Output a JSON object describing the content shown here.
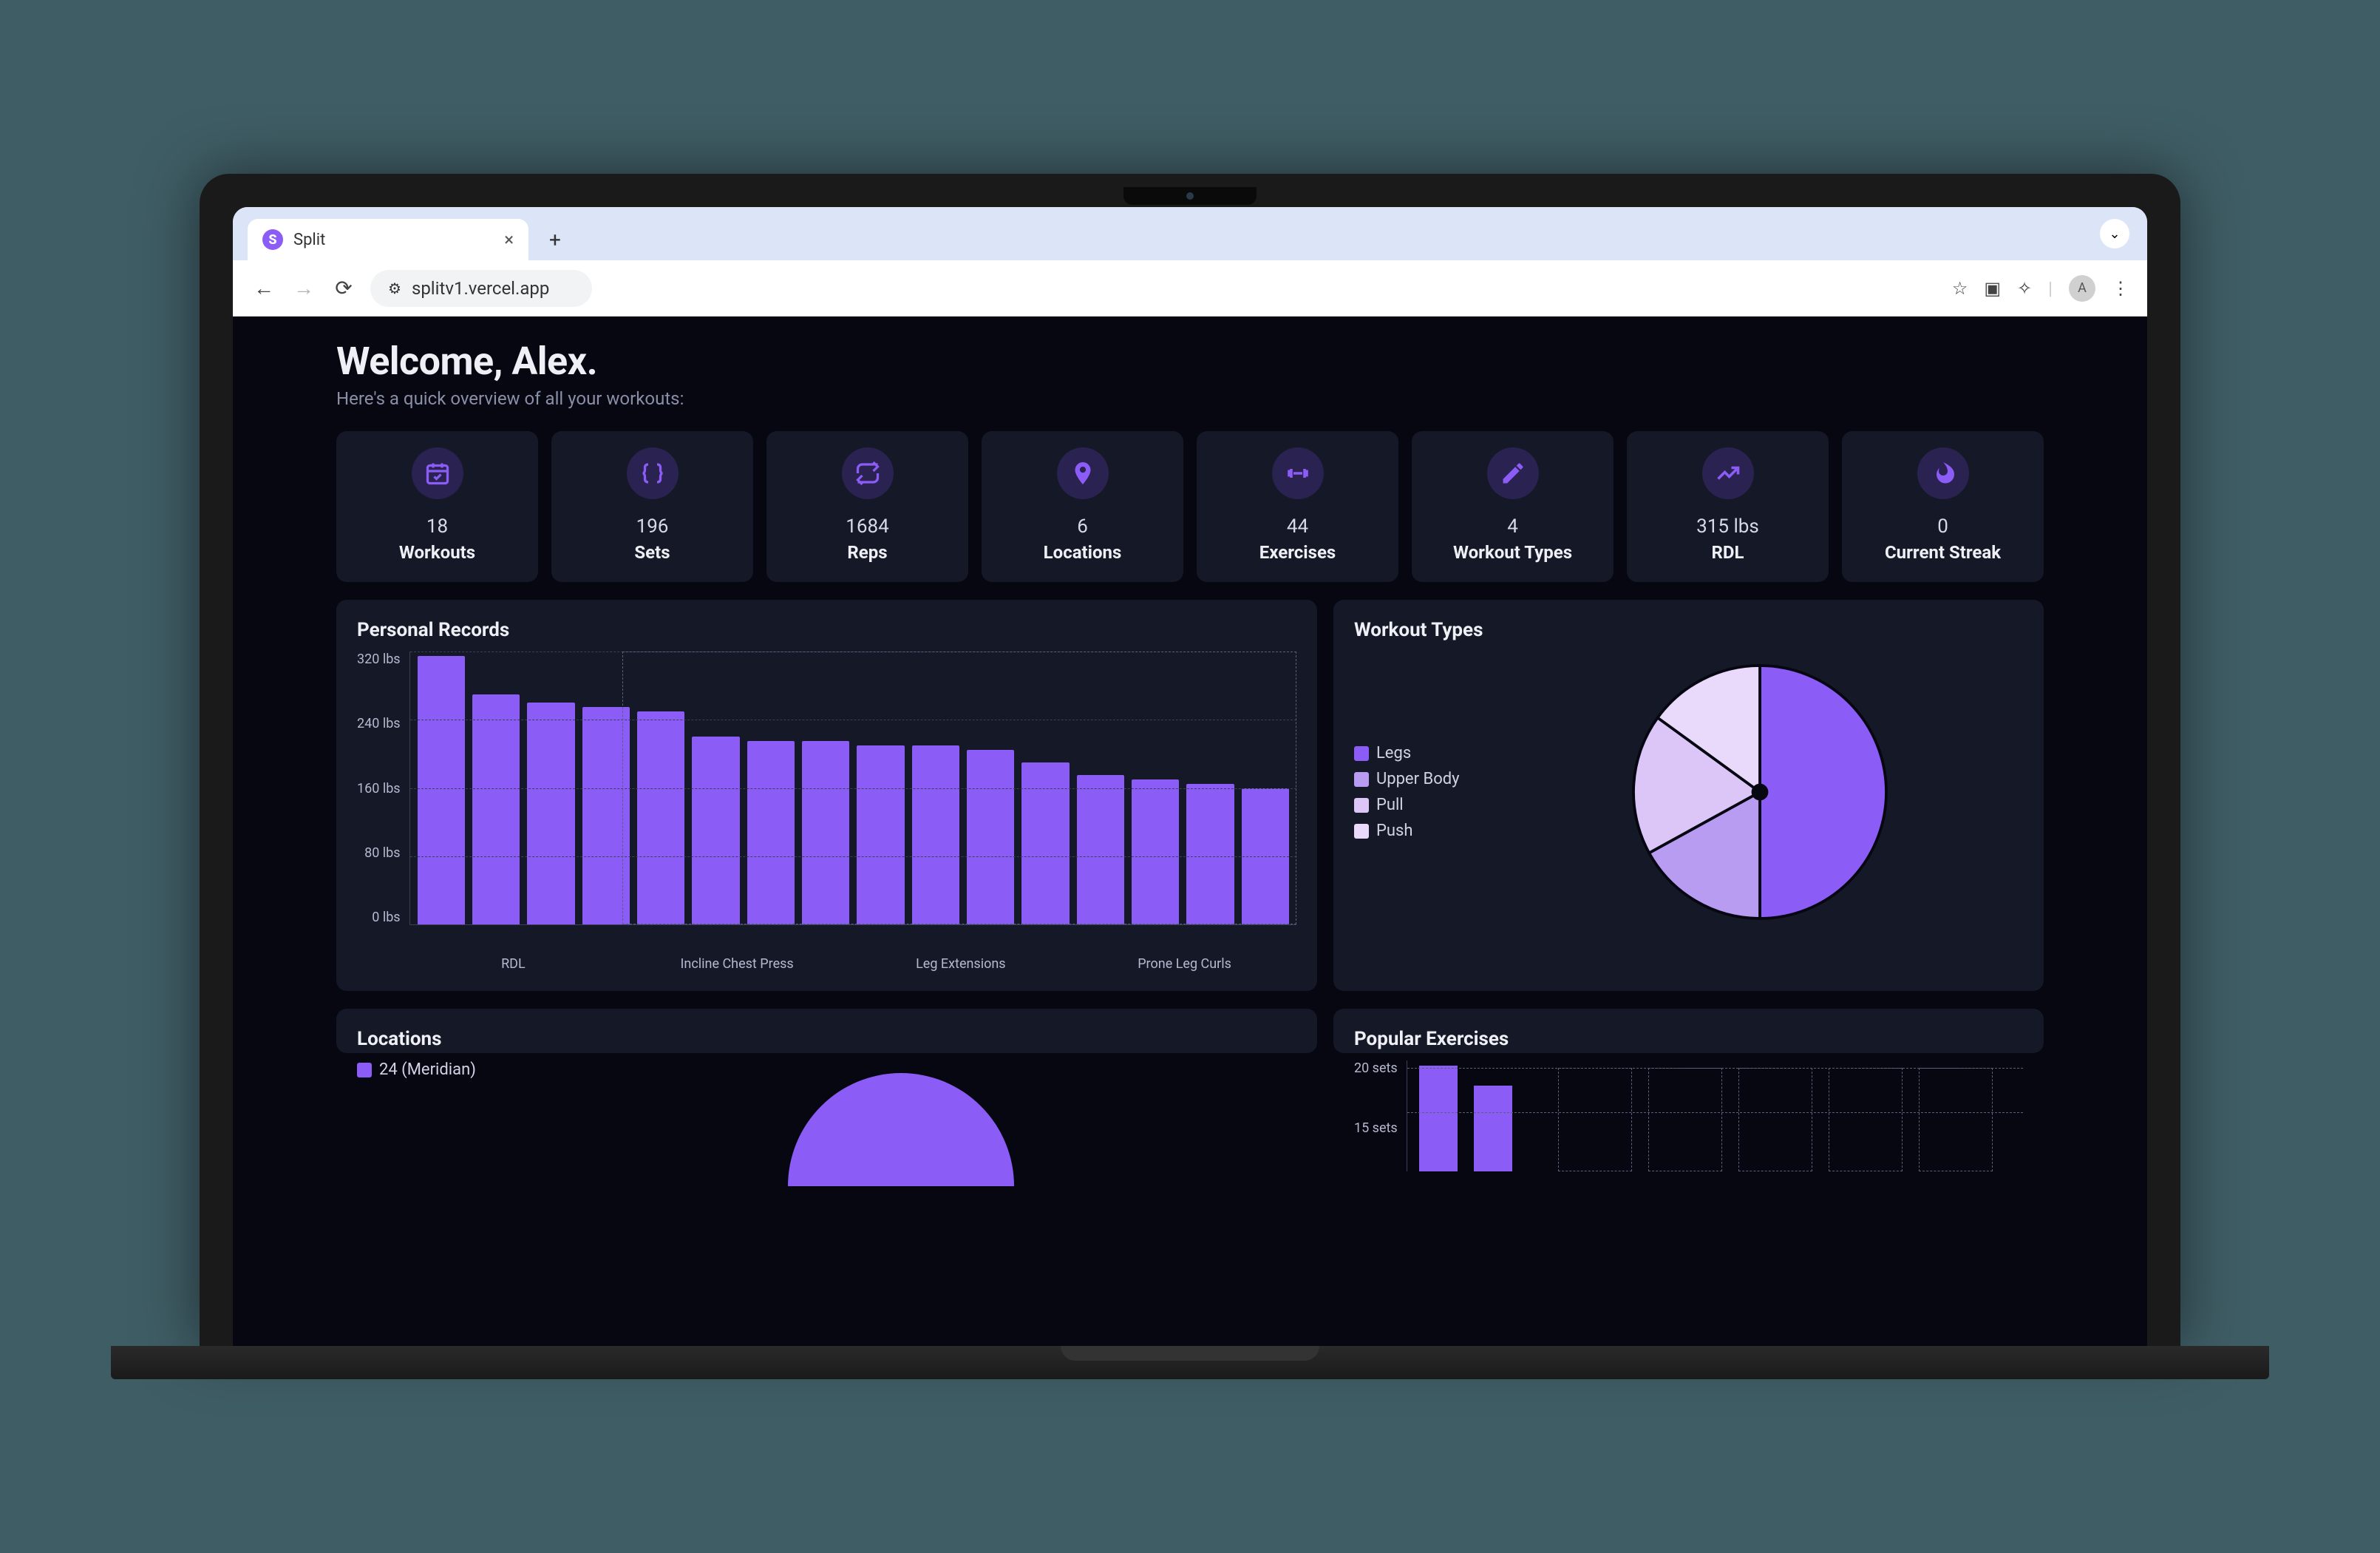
{
  "browser": {
    "tab_title": "Split",
    "url": "splitv1.vercel.app",
    "avatar_letter": "A"
  },
  "welcome": {
    "heading": "Welcome, Alex.",
    "subtitle": "Here's a quick overview of all your workouts:"
  },
  "stats": [
    {
      "value": "18",
      "label": "Workouts",
      "icon": "calendar"
    },
    {
      "value": "196",
      "label": "Sets",
      "icon": "braces"
    },
    {
      "value": "1684",
      "label": "Reps",
      "icon": "repeat"
    },
    {
      "value": "6",
      "label": "Locations",
      "icon": "pin"
    },
    {
      "value": "44",
      "label": "Exercises",
      "icon": "dumbbell"
    },
    {
      "value": "4",
      "label": "Workout Types",
      "icon": "pencil"
    },
    {
      "value": "315 lbs",
      "label": "RDL",
      "icon": "trend"
    },
    {
      "value": "0",
      "label": "Current Streak",
      "icon": "flame"
    }
  ],
  "panels": {
    "personal_records": {
      "title": "Personal Records"
    },
    "workout_types": {
      "title": "Workout Types"
    },
    "locations": {
      "title": "Locations"
    },
    "popular": {
      "title": "Popular Exercises"
    }
  },
  "workout_types_legend": [
    {
      "label": "Legs",
      "color": "#8b5cf6"
    },
    {
      "label": "Upper Body",
      "color": "#b79cf2"
    },
    {
      "label": "Pull",
      "color": "#dbc6f7"
    },
    {
      "label": "Push",
      "color": "#e9d9fb"
    }
  ],
  "locations_legend": [
    {
      "label": "24 (Meridian)",
      "color": "#8b5cf6"
    }
  ],
  "chart_data": [
    {
      "type": "bar",
      "title": "Personal Records",
      "ylabel": "lbs",
      "ylim": [
        0,
        320
      ],
      "y_ticks": [
        "320 lbs",
        "240 lbs",
        "160 lbs",
        "80 lbs",
        "0 lbs"
      ],
      "categories": [
        "RDL",
        "",
        "",
        "",
        "Incline Chest Press",
        "",
        "",
        "Leg Extensions",
        "",
        "",
        "Prone Leg Curls",
        "",
        "",
        ""
      ],
      "x_tick_labels": [
        "RDL",
        "Incline Chest Press",
        "Leg Extensions",
        "Prone Leg Curls"
      ],
      "values": [
        315,
        270,
        260,
        255,
        250,
        220,
        215,
        215,
        210,
        210,
        205,
        190,
        175,
        170,
        165,
        160
      ]
    },
    {
      "type": "pie",
      "title": "Workout Types",
      "series": [
        {
          "name": "Legs",
          "value": 50,
          "color": "#8b5cf6"
        },
        {
          "name": "Upper Body",
          "value": 17,
          "color": "#b79cf2"
        },
        {
          "name": "Pull",
          "value": 18,
          "color": "#dbc6f7"
        },
        {
          "name": "Push",
          "value": 15,
          "color": "#e9d9fb"
        }
      ]
    },
    {
      "type": "pie",
      "title": "Locations",
      "series": [
        {
          "name": "24 (Meridian)",
          "value": 100,
          "color": "#8b5cf6"
        }
      ]
    },
    {
      "type": "bar",
      "title": "Popular Exercises",
      "ylabel": "sets",
      "y_ticks": [
        "20 sets",
        "15 sets"
      ],
      "ylim": [
        0,
        22
      ],
      "values": [
        21,
        17
      ],
      "categories": [
        "",
        ""
      ]
    }
  ],
  "colors": {
    "accent": "#8b5cf6",
    "panel": "#151826",
    "bg": "#070712"
  }
}
